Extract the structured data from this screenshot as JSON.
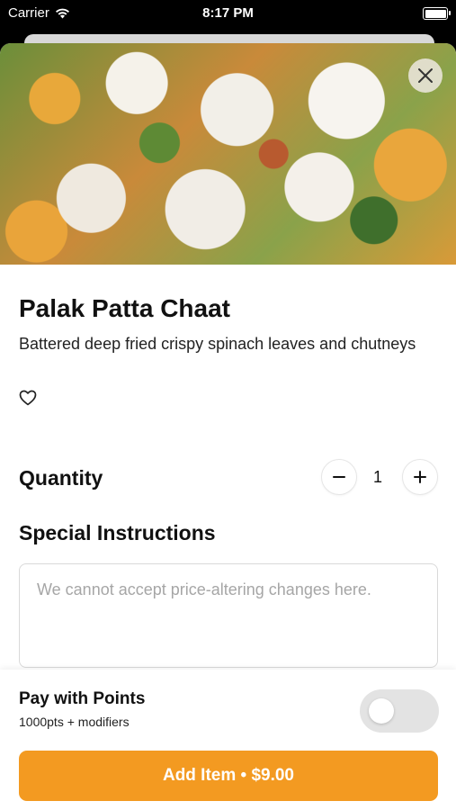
{
  "status_bar": {
    "carrier": "Carrier",
    "time": "8:17 PM"
  },
  "item": {
    "title": "Palak Patta Chaat",
    "description": "Battered deep fried crispy spinach leaves and chutneys",
    "image_icon": "food-photo"
  },
  "quantity": {
    "label": "Quantity",
    "value": "1",
    "minus_icon": "minus-icon",
    "plus_icon": "plus-icon"
  },
  "special_instructions": {
    "label": "Special Instructions",
    "placeholder": "We cannot accept price-altering changes here.",
    "value": ""
  },
  "pay_with_points": {
    "label": "Pay with Points",
    "sublabel": "1000pts + modifiers",
    "enabled": false
  },
  "add_button": {
    "label": "Add Item • $9.00"
  },
  "colors": {
    "accent": "#f39a21",
    "toggle_off": "#e3e3e3"
  }
}
